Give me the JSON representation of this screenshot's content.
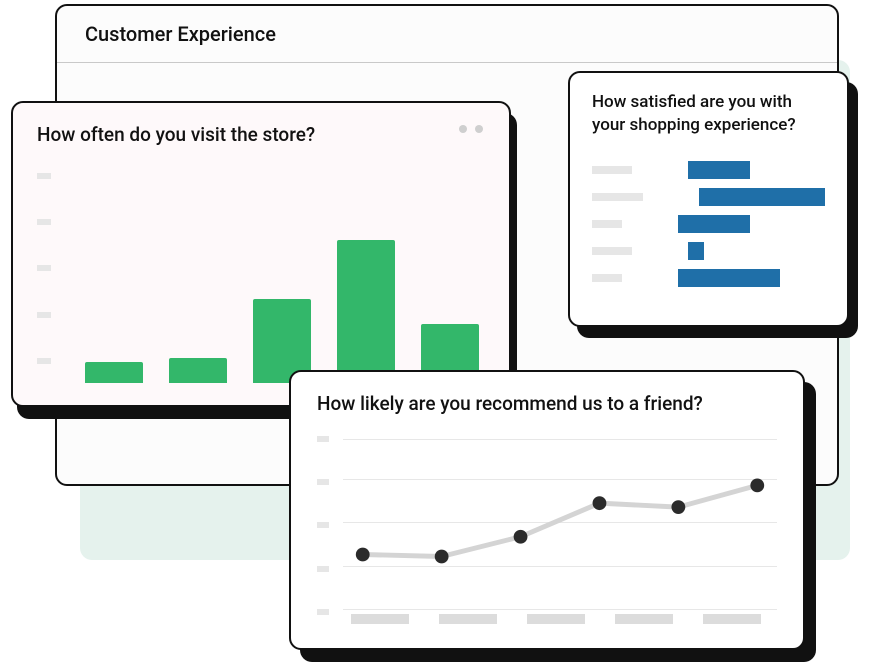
{
  "main": {
    "title": "Customer Experience"
  },
  "bar": {
    "question": "How often do you visit the store?"
  },
  "sat": {
    "question": "How satisfied are you with your shopping experience?"
  },
  "line": {
    "question": "How likely are you recommend us to a friend?"
  },
  "chart_data": [
    {
      "type": "bar",
      "title": "How often do you visit the store?",
      "categories": [
        "",
        "",
        "",
        "",
        ""
      ],
      "values": [
        10,
        12,
        40,
        68,
        28
      ],
      "ylim": [
        0,
        100
      ]
    },
    {
      "type": "bar",
      "orientation": "horizontal",
      "title": "How satisfied are you with your shopping experience?",
      "categories": [
        "",
        "",
        "",
        "",
        ""
      ],
      "values": [
        48,
        100,
        55,
        12,
        78
      ],
      "xlim": [
        0,
        100
      ]
    },
    {
      "type": "line",
      "title": "How likely are you recommend us to a friend?",
      "x": [
        1,
        2,
        3,
        4,
        5,
        6
      ],
      "values": [
        28,
        28,
        40,
        60,
        58,
        70
      ],
      "ylim": [
        0,
        100
      ]
    }
  ]
}
